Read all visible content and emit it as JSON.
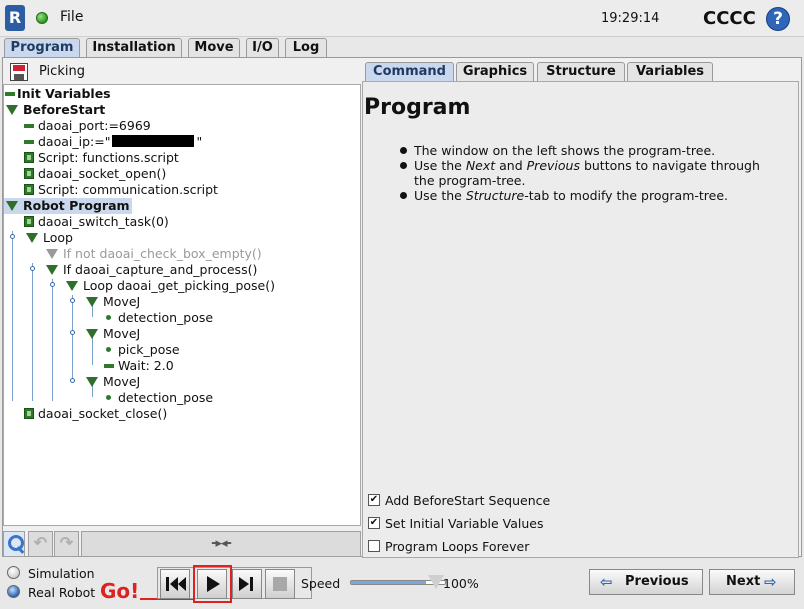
{
  "header": {
    "logo": "R",
    "file_menu": "File",
    "clock": "19:29:14",
    "robot_name": "CCCC",
    "help": "?"
  },
  "tabs": [
    {
      "label": "Program"
    },
    {
      "label": "Installation"
    },
    {
      "label": "Move"
    },
    {
      "label": "I/O"
    },
    {
      "label": "Log"
    }
  ],
  "program": {
    "name": "Picking"
  },
  "tree": [
    {
      "text": "Init Variables"
    },
    {
      "text": "BeforeStart"
    },
    {
      "text": "daoai_port:=6969"
    },
    {
      "text_pre": "daoai_ip:=\"",
      "text_post": "\""
    },
    {
      "text": "Script: functions.script"
    },
    {
      "text": "daoai_socket_open()"
    },
    {
      "text": "Script: communication.script"
    },
    {
      "text": "Robot Program"
    },
    {
      "text": "daoai_switch_task(0)"
    },
    {
      "text": "Loop"
    },
    {
      "text": "If  not daoai_check_box_empty()"
    },
    {
      "text": "If daoai_capture_and_process()"
    },
    {
      "text": "Loop daoai_get_picking_pose()"
    },
    {
      "text": "MoveJ"
    },
    {
      "text": "detection_pose"
    },
    {
      "text": "MoveJ"
    },
    {
      "text": "pick_pose"
    },
    {
      "text": "Wait: 2.0"
    },
    {
      "text": "MoveJ"
    },
    {
      "text": "detection_pose"
    },
    {
      "text": "daoai_socket_close()"
    }
  ],
  "left_toolbar": {
    "collapse_expand": "-▸◂-"
  },
  "right_tabs": [
    {
      "label": "Command"
    },
    {
      "label": "Graphics"
    },
    {
      "label": "Structure"
    },
    {
      "label": "Variables"
    }
  ],
  "command": {
    "title": "Program",
    "bullets": [
      {
        "parts": [
          "The window on the left shows the program-tree."
        ]
      },
      {
        "parts": [
          "Use the ",
          "Next",
          " and ",
          "Previous",
          " buttons to navigate through the program-tree."
        ]
      },
      {
        "parts": [
          "Use the ",
          "Structure",
          "-tab to modify the program-tree."
        ]
      }
    ],
    "options": [
      {
        "label": "Add BeforeStart Sequence",
        "checked": true
      },
      {
        "label": "Set Initial Variable Values",
        "checked": true
      },
      {
        "label": "Program Loops Forever",
        "checked": false
      }
    ]
  },
  "bottom": {
    "modes": [
      {
        "label": "Simulation",
        "selected": false
      },
      {
        "label": "Real Robot",
        "selected": true
      }
    ],
    "annotation": "Go!",
    "speed_label": "Speed",
    "speed_value": "100%",
    "speed_fraction": 1.0,
    "prev_label": "Previous",
    "next_label": "Next"
  },
  "colors": {
    "accent_blue": "#2f66b8",
    "annotation_red": "#d22",
    "tree_green": "#2f7a2a"
  }
}
